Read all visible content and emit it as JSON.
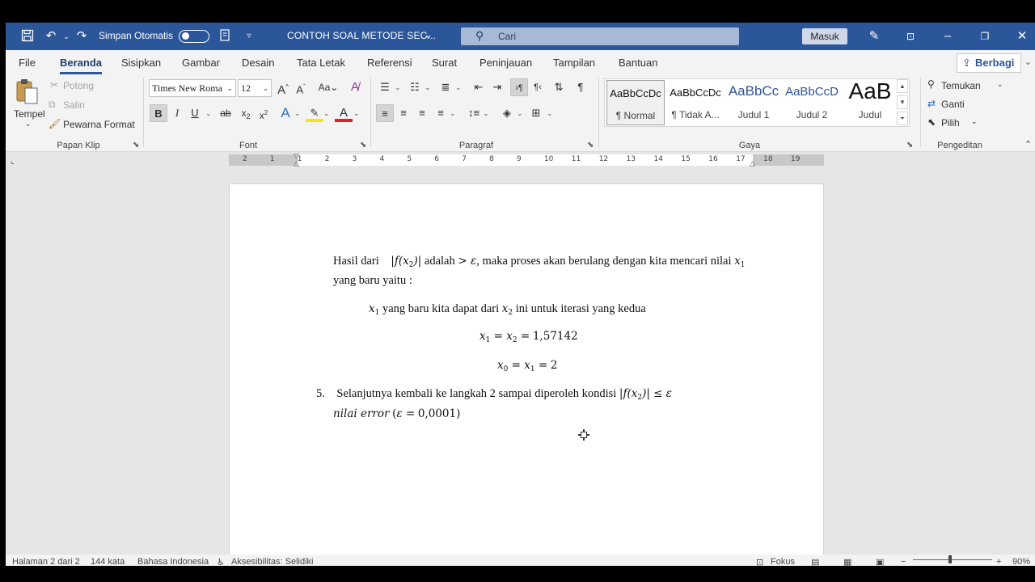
{
  "titlebar": {
    "autosave_label": "Simpan Otomatis",
    "document_title": "CONTOH SOAL METODE SEC...",
    "search_placeholder": "Cari",
    "signin_label": "Masuk",
    "accent_color": "#2b579a"
  },
  "menu": {
    "tabs": [
      "File",
      "Beranda",
      "Sisipkan",
      "Gambar",
      "Desain",
      "Tata Letak",
      "Referensi",
      "Surat",
      "Peninjauan",
      "Tampilan",
      "Bantuan"
    ],
    "active_tab": "Beranda",
    "share_label": "Berbagi"
  },
  "ribbon": {
    "clipboard": {
      "paste_label": "Tempel",
      "cut_label": "Potong",
      "copy_label": "Salin",
      "format_painter_label": "Pewarna Format",
      "group_label": "Papan Klip"
    },
    "font": {
      "font_name": "Times New Roma",
      "font_size": "12",
      "group_label": "Font"
    },
    "paragraph": {
      "group_label": "Paragraf"
    },
    "styles": {
      "items": [
        {
          "preview": "AaBbCcDc",
          "name": "¶ Normal"
        },
        {
          "preview": "AaBbCcDc",
          "name": "¶ Tidak A..."
        },
        {
          "preview": "AaBbCc",
          "name": "Judul 1"
        },
        {
          "preview": "AaBbCcD",
          "name": "Judul 2"
        },
        {
          "preview": "AaB",
          "name": "Judul"
        }
      ],
      "group_label": "Gaya"
    },
    "editing": {
      "find_label": "Temukan",
      "replace_label": "Ganti",
      "select_label": "Pilih",
      "group_label": "Pengeditan"
    }
  },
  "ruler": {
    "marks": [
      "2",
      "1",
      "1",
      "2",
      "3",
      "4",
      "5",
      "6",
      "7",
      "8",
      "9",
      "10",
      "11",
      "12",
      "13",
      "14",
      "15",
      "16",
      "17",
      "18",
      "19"
    ]
  },
  "document": {
    "p1_text_a": "Hasil dari",
    "p1_text_b": "adalah",
    "p1_text_c": ", maka proses akan berulang dengan kita mencari nilai",
    "p1_text_d": "yang baru yaitu :",
    "p2_text": "yang baru kita dapat dari",
    "p2_text_b": "ini untuk iterasi yang kedua",
    "eq1_value": "1,57142",
    "eq2_value": "2",
    "item_number": "5.",
    "item_text": "Selanjutnya kembali ke langkah 2 sampai diperoleh kondisi",
    "item_line2_italic": "nilai error",
    "item_line2_value": "0,0001"
  },
  "status": {
    "page": "Halaman 2 dari 2",
    "words": "144 kata",
    "language": "Bahasa Indonesia",
    "accessibility": "Aksesibilitas: Selidiki",
    "focus": "Fokus",
    "zoom": "90%"
  }
}
